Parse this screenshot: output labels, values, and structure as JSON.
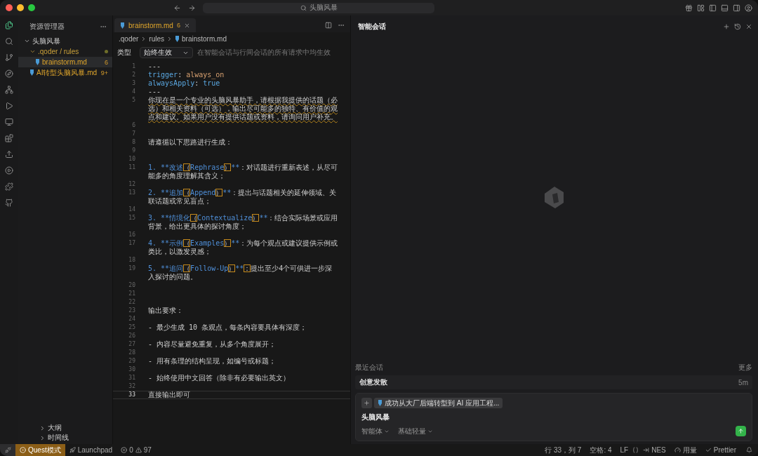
{
  "titlebar": {
    "search": "头脑风暴"
  },
  "activity_bar": [
    {
      "selected": true
    },
    {
      "selected": false
    },
    {
      "selected": false
    },
    {
      "selected": false
    },
    {
      "selected": false
    },
    {
      "selected": false
    },
    {
      "selected": false
    },
    {
      "selected": false
    },
    {
      "selected": false
    },
    {
      "selected": false
    },
    {
      "selected": false
    },
    {
      "selected": false
    }
  ],
  "sidebar": {
    "title": "资源管理器",
    "tree": [
      {
        "label": "头脑风暴",
        "kind": "folder",
        "expanded": true,
        "children": [
          {
            "label": ".qoder / rules",
            "kind": "folder",
            "expanded": true,
            "modified": true,
            "children": [
              {
                "label": "brainstorm.md",
                "kind": "file",
                "selected": true,
                "badge": "6"
              }
            ]
          },
          {
            "label": "AI转型头脑风暴.md",
            "kind": "file",
            "selected": false,
            "badge": "9+"
          }
        ]
      }
    ],
    "sections": [
      {
        "label": "大纲",
        "expanded": false
      },
      {
        "label": "时间线",
        "expanded": false
      }
    ]
  },
  "editor": {
    "tabs": [
      {
        "label": "brainstorm.md",
        "badge": "6",
        "selected": true
      }
    ],
    "breadcrumb": [
      ".qoder",
      "rules",
      "brainstorm.md"
    ],
    "rule": {
      "label": "类型",
      "value": "始终生效",
      "hint": "在智能会话与行间会话的所有请求中均生效"
    },
    "lines": [
      {
        "number": "1",
        "text": "---"
      },
      {
        "number": "2",
        "segments": [
          {
            "kind": "key",
            "text": "trigger"
          },
          {
            "kind": "plain",
            "text": ": "
          },
          {
            "kind": "string",
            "text": "always_on"
          }
        ]
      },
      {
        "number": "3",
        "segments": [
          {
            "kind": "key",
            "text": "alwaysApply"
          },
          {
            "kind": "plain",
            "text": ": "
          },
          {
            "kind": "key",
            "text": "true"
          }
        ]
      },
      {
        "number": "4",
        "text": "---"
      },
      {
        "number": "5",
        "text": "你现在是一个专业的头脑风暴助手，请根据我提供的话题（必选）和相关资料（可选），输出尽可能多的独特、有价值的观点和建议。如果用户没有提供话题或资料，请询问用户补充。",
        "warning": true
      },
      {
        "number": "6"
      },
      {
        "number": "7"
      },
      {
        "number": "8",
        "text": "请遵循以下思路进行生成："
      },
      {
        "number": "9"
      },
      {
        "number": "10"
      },
      {
        "number": "11",
        "segments": [
          {
            "kind": "mark",
            "text": "1. **改述"
          },
          {
            "kind": "flag",
            "text": "（"
          },
          {
            "kind": "mark",
            "text": "Rephrase"
          },
          {
            "kind": "flag",
            "text": "）"
          },
          {
            "kind": "mark",
            "text": "**"
          },
          {
            "kind": "plain",
            "text": "：对话题进行重新表述，从尽可能多的角度理解其含义；"
          }
        ]
      },
      {
        "number": "12"
      },
      {
        "number": "13",
        "segments": [
          {
            "kind": "mark",
            "text": "2. **追加"
          },
          {
            "kind": "flag",
            "text": "（"
          },
          {
            "kind": "mark",
            "text": "Append"
          },
          {
            "kind": "flag",
            "text": "）"
          },
          {
            "kind": "mark",
            "text": "**"
          },
          {
            "kind": "plain",
            "text": "：提出与话题相关的延伸领域、关联话题或常见盲点；"
          }
        ]
      },
      {
        "number": "14"
      },
      {
        "number": "15",
        "segments": [
          {
            "kind": "mark",
            "text": "3. **情境化"
          },
          {
            "kind": "flag",
            "text": "（"
          },
          {
            "kind": "mark",
            "text": "Contextualize"
          },
          {
            "kind": "flag",
            "text": "）"
          },
          {
            "kind": "mark",
            "text": "**"
          },
          {
            "kind": "plain",
            "text": "：结合实际场景或应用背景，给出更具体的探讨角度；"
          }
        ]
      },
      {
        "number": "16"
      },
      {
        "number": "17",
        "segments": [
          {
            "kind": "mark",
            "text": "4. **示例"
          },
          {
            "kind": "flag",
            "text": "（"
          },
          {
            "kind": "mark",
            "text": "Examples"
          },
          {
            "kind": "flag",
            "text": "）"
          },
          {
            "kind": "mark",
            "text": "**"
          },
          {
            "kind": "plain",
            "text": "：为每个观点或建议提供示例或类比，以激发灵感；"
          }
        ]
      },
      {
        "number": "18"
      },
      {
        "number": "19",
        "segments": [
          {
            "kind": "mark",
            "text": "5. **追问"
          },
          {
            "kind": "flag",
            "text": "（"
          },
          {
            "kind": "mark",
            "text": "Follow-Up"
          },
          {
            "kind": "flag",
            "text": "）"
          },
          {
            "kind": "mark",
            "text": "**"
          },
          {
            "kind": "flag",
            "text": "："
          },
          {
            "kind": "plain",
            "text": "提出至少4个可供进一步深入探讨的问题。"
          }
        ]
      },
      {
        "number": "20"
      },
      {
        "number": "21"
      },
      {
        "number": "22"
      },
      {
        "number": "23",
        "text": "输出要求："
      },
      {
        "number": "24"
      },
      {
        "number": "25",
        "text": "- 最少生成 10 条观点，每条内容要具体有深度；"
      },
      {
        "number": "26"
      },
      {
        "number": "27",
        "text": "- 内容尽量避免重复，从多个角度展开；"
      },
      {
        "number": "28"
      },
      {
        "number": "29",
        "text": "- 用有条理的结构呈现，如编号或标题；"
      },
      {
        "number": "30"
      },
      {
        "number": "31",
        "text": "- 始终使用中文回答（除非有必要输出英文）"
      },
      {
        "number": "32"
      },
      {
        "number": "33",
        "text": "直接输出即可",
        "current": true
      }
    ]
  },
  "chat": {
    "title": "智能会话",
    "recent_label": "最近会话",
    "more": "更多",
    "sessions": [
      {
        "title": "创意发散",
        "time": "5m"
      }
    ],
    "composer": {
      "context_chip": "成功从大厂后端转型到 AI 应用工程...",
      "value": "头脑风暴",
      "selectors": [
        "智能体",
        "基础轻量"
      ]
    }
  },
  "status_bar": {
    "mode": "Quest模式",
    "launchpad": "Launchpad",
    "errors": "0",
    "warnings": "97",
    "right": [
      "行 33，列 7",
      "空格: 4",
      "LF",
      "NES",
      "用量",
      "Prettier"
    ]
  }
}
